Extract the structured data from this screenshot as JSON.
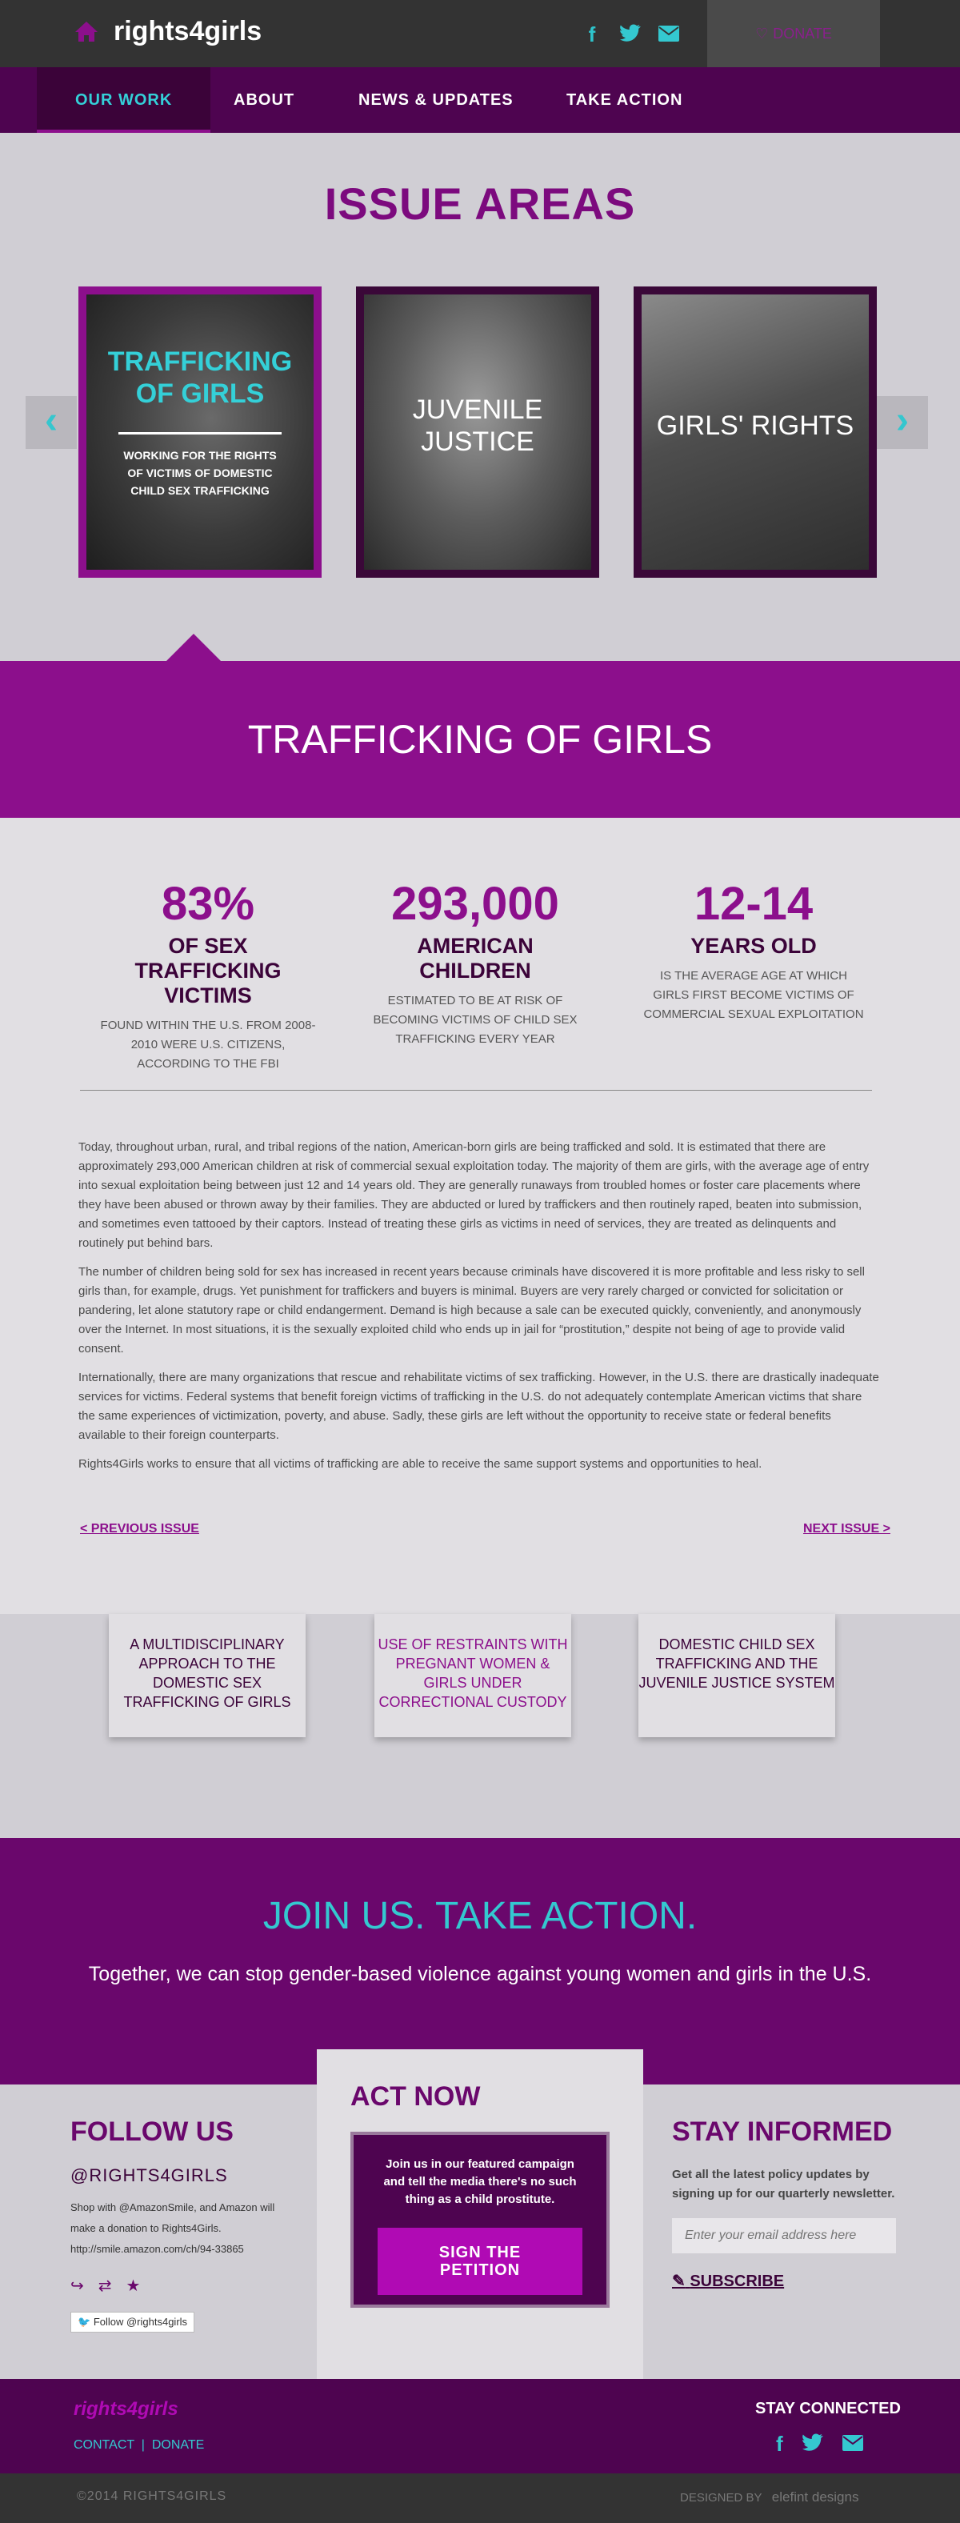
{
  "header": {
    "logo": "rights4girls",
    "donate_label": "DONATE"
  },
  "nav": {
    "items": [
      {
        "label": "OUR WORK"
      },
      {
        "label": "ABOUT"
      },
      {
        "label": "NEWS & UPDATES"
      },
      {
        "label": "TAKE ACTION"
      }
    ]
  },
  "issue_areas": {
    "title": "ISSUE AREAS",
    "cards": [
      {
        "title": "TRAFFICKING OF GIRLS",
        "subtitle": "WORKING FOR THE RIGHTS OF VICTIMS OF DOMESTIC CHILD SEX TRAFFICKING"
      },
      {
        "title": "JUVENILE JUSTICE"
      },
      {
        "title": "GIRLS' RIGHTS"
      }
    ]
  },
  "selected_issue": {
    "title": "TRAFFICKING OF GIRLS",
    "stats": [
      {
        "value": "83%",
        "label": "OF SEX TRAFFICKING VICTIMS",
        "desc": "FOUND WITHIN THE U.S. FROM 2008-2010 WERE U.S. CITIZENS, ACCORDING TO THE FBI"
      },
      {
        "value": "293,000",
        "label": "AMERICAN CHILDREN",
        "desc": "ESTIMATED TO BE AT RISK OF BECOMING VICTIMS OF CHILD SEX TRAFFICKING EVERY YEAR"
      },
      {
        "value": "12-14",
        "label": "YEARS OLD",
        "desc": "IS THE AVERAGE AGE AT WHICH GIRLS FIRST BECOME VICTIMS OF COMMERCIAL SEXUAL EXPLOITATION"
      }
    ],
    "paragraphs": [
      "Today, throughout urban, rural, and tribal regions of the nation, American-born girls are being trafficked and sold.  It is estimated that there are approximately 293,000 American children at risk of commercial sexual exploitation today. The majority of them are girls, with the average age of entry into sexual exploitation being between just 12 and 14 years old. They are generally runaways from troubled homes or foster care placements where they have been abused or thrown away by their families. They are abducted or lured by traffickers and then routinely raped, beaten into submission, and sometimes even tattooed by their captors. Instead of treating these girls as victims in need of services, they are treated as delinquents and routinely put behind bars.",
      "The number of children being sold for sex has increased in recent years because criminals have discovered it is more profitable and less risky to sell girls than, for example, drugs. Yet punishment for traffickers and buyers is minimal. Buyers are very rarely charged or convicted for solicitation or pandering, let alone statutory rape or child endangerment. Demand is high because a sale can be executed quickly, conveniently, and anonymously over the Internet. In most situations, it is the sexually exploited child who ends up in jail for “prostitution,” despite not being of age to provide valid consent.",
      "Internationally, there are many organizations that rescue and rehabilitate victims of sex trafficking. However, in the U.S. there are drastically inadequate services for victims. Federal systems that benefit foreign victims of trafficking in the U.S. do not adequately contemplate American victims that share the same experiences of victimization, poverty, and abuse. Sadly, these girls are left without the opportunity to receive state or federal benefits available to their foreign counterparts.",
      "Rights4Girls works to ensure that all victims of trafficking are able to receive the same support systems and opportunities to heal."
    ],
    "prev_label": "< PREVIOUS ISSUE",
    "next_label": "NEXT ISSUE >"
  },
  "related": [
    {
      "label": "A MULTIDISCIPLINARY APPROACH TO THE DOMESTIC SEX TRAFFICKING OF GIRLS",
      "color": "#3b0339"
    },
    {
      "label": "USE OF RESTRAINTS WITH PREGNANT WOMEN & GIRLS UNDER CORRECTIONAL CUSTODY",
      "color": "#8c0f8c"
    },
    {
      "label": "DOMESTIC CHILD SEX TRAFFICKING AND THE JUVENILE JUSTICE SYSTEM",
      "color": "#3b0339"
    }
  ],
  "join": {
    "title": "JOIN US. TAKE ACTION.",
    "subtitle": "Together, we can stop gender-based violence against young women and girls in the U.S."
  },
  "follow": {
    "title": "FOLLOW US",
    "handle": "@RIGHTS4GIRLS",
    "text": "Shop with @AmazonSmile, and Amazon will make a donation to Rights4Girls. http://smile.amazon.com/ch/94-33865",
    "button": "Follow @rights4girls"
  },
  "act_now": {
    "title": "ACT NOW",
    "text": "Join us in our featured campaign and tell the media there's no such thing as a child prostitute.",
    "button": "SIGN THE PETITION"
  },
  "stay_informed": {
    "title": "STAY INFORMED",
    "text": "Get all the latest policy updates by signing up for our quarterly newsletter.",
    "placeholder": "Enter your email address here",
    "subscribe": "SUBSCRIBE"
  },
  "footer": {
    "logo": "rights4girls",
    "contact": "CONTACT",
    "donate": "DONATE",
    "stay_connected": "STAY CONNECTED",
    "copyright": "©2014 RIGHTS4GIRLS",
    "designed_by": "DESIGNED BY",
    "designer": "elefint designs"
  },
  "colors": {
    "purple_dark": "#4e0450",
    "purple": "#8c0f8c",
    "teal": "#34c8d0"
  }
}
